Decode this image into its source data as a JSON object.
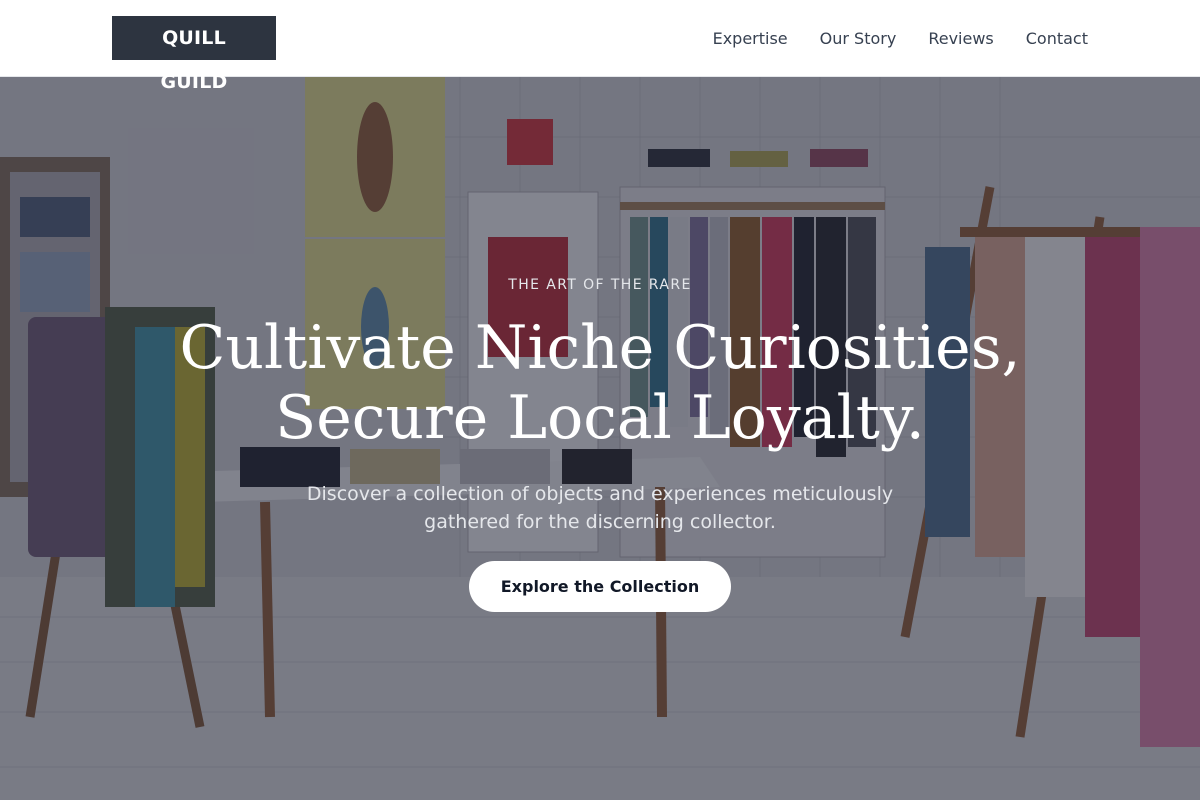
{
  "brand": {
    "name": "QUILL GUILD"
  },
  "nav": {
    "items": [
      {
        "label": "Expertise"
      },
      {
        "label": "Our Story"
      },
      {
        "label": "Reviews"
      },
      {
        "label": "Contact"
      }
    ]
  },
  "hero": {
    "eyebrow": "THE ART OF THE RARE",
    "headline_line1": "Cultivate Niche Curiosities,",
    "headline_line2": "Secure Local Loyalty.",
    "subtext": "Discover a collection of objects and experiences meticulously gathered for the discerning collector.",
    "cta_label": "Explore the Collection",
    "background_image": "clothing-boutique-interior-photo"
  },
  "colors": {
    "logo_bg": "#2d3440",
    "nav_text": "#374151",
    "overlay": "#202130",
    "cta_bg": "#ffffff",
    "cta_text": "#111827"
  }
}
